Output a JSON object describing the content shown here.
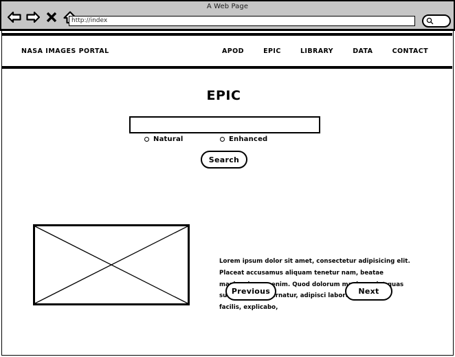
{
  "browser": {
    "window_title": "A Web Page",
    "url_value": "http://index",
    "url_placeholder": "http://index",
    "chrome_search_value": "",
    "icons": {
      "back": "back-arrow-icon",
      "forward": "forward-arrow-icon",
      "stop": "close-x-icon",
      "home": "home-icon",
      "search": "magnifier-icon"
    }
  },
  "sitenav": {
    "brand": "NASA IMAGES PORTAL",
    "links": [
      {
        "label": "APOD"
      },
      {
        "label": "EPIC"
      },
      {
        "label": "LIBRARY"
      },
      {
        "label": "DATA"
      },
      {
        "label": "CONTACT"
      }
    ]
  },
  "main": {
    "title": "EPIC",
    "search": {
      "value": "",
      "placeholder": ""
    },
    "radios": [
      {
        "label": "Natural",
        "selected": false
      },
      {
        "label": "Enhanced",
        "selected": false
      }
    ],
    "search_button": "Search",
    "image_placeholder_alt": "image-placeholder",
    "description": "Lorem ipsum dolor sit amet, consectetur adipisicing elit. Placeat accusamus aliquam tenetur nam, beatae maxime harum enim. Quod dolorum maxime, sint quas suscipit vel aspernatur, adipisci laborum? Maxime facilis, explicabo,",
    "previous_button": "Previous",
    "next_button": "Next"
  },
  "colors": {
    "chrome_background": "#c6c6c6",
    "ink": "#000000",
    "page_background": "#ffffff"
  }
}
